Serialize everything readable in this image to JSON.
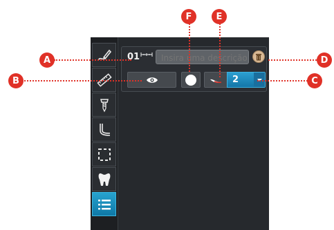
{
  "toolbar": {
    "tools": [
      {
        "name": "pencil-draw-icon",
        "active": false
      },
      {
        "name": "ruler-icon",
        "active": false
      },
      {
        "name": "implant-icon",
        "active": false
      },
      {
        "name": "curve-icon",
        "active": false
      },
      {
        "name": "selection-icon",
        "active": false
      },
      {
        "name": "tooth-icon",
        "active": false
      },
      {
        "name": "list-icon",
        "active": true
      }
    ]
  },
  "measurement": {
    "number": "01",
    "description_placeholder": "Insira uma descrição",
    "selected_value": "2"
  },
  "callouts": {
    "a": "A",
    "b": "B",
    "c": "C",
    "d": "D",
    "e": "E",
    "f": "F"
  },
  "colors": {
    "accent": "#1a8fc4",
    "callout": "#e03127",
    "panel": "#26292d"
  }
}
